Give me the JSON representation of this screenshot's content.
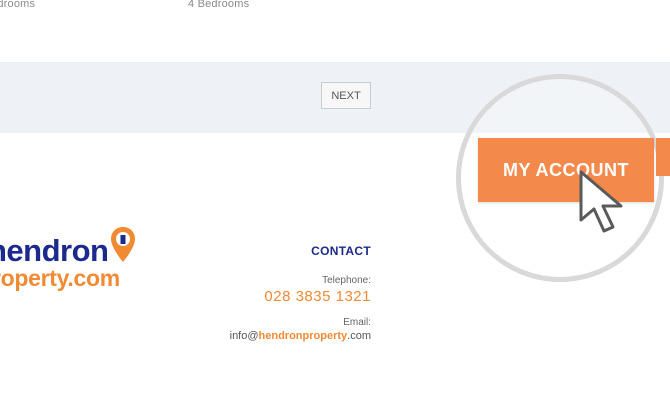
{
  "listings": {
    "left_partial": "edrooms",
    "right": "4 Bedrooms"
  },
  "pagination": {
    "next_label": "NEXT"
  },
  "logo": {
    "line1": "hendron",
    "line2": "roperty.com"
  },
  "contact": {
    "title": "CONTACT",
    "telephone_label": "Telephone:",
    "telephone": "028 3835 1321",
    "email_label": "Email:",
    "email_user": "info@",
    "email_domain": "hendronproperty",
    "email_tld": ".com"
  },
  "callout": {
    "account_label": "MY ACCOUNT"
  },
  "colors": {
    "brand_blue": "#1b2a8c",
    "brand_orange": "#f08a33",
    "account_button": "#f3894a",
    "band_bg": "#eef2f6"
  },
  "icons": [
    "map-pin-icon",
    "mouse-pointer-icon"
  ]
}
